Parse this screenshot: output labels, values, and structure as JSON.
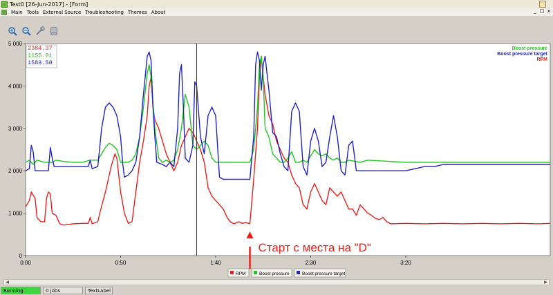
{
  "window": {
    "title": "Test0 [26-Jun-2017] - [Form]"
  },
  "menu": {
    "items": [
      "Main",
      "Tools",
      "External Source",
      "Troubleshooting",
      "Themes",
      "About"
    ],
    "controls": [
      "_",
      "□",
      "x"
    ]
  },
  "toolbar": {
    "buttons": [
      "zoom-in-icon",
      "zoom-out-icon",
      "settings-icon",
      "database-icon"
    ]
  },
  "readouts": [
    {
      "value": "2384.37",
      "color": "#e8201c"
    },
    {
      "value": "1155.91",
      "color": "#22c422"
    },
    {
      "value": "1583.58",
      "color": "#1e22c8"
    }
  ],
  "annotation": {
    "text": "Старт с места на \"D\"",
    "color": "#e8201c"
  },
  "chart_data": {
    "type": "line",
    "x_unit": "seconds",
    "xlim": [
      0,
      276
    ],
    "ylim": [
      0,
      5000
    ],
    "y_ticks": [
      "0",
      "1 000",
      "2 000",
      "3 000",
      "4 000",
      "5 000"
    ],
    "x_ticks": [
      {
        "value": 0,
        "label": "0:00"
      },
      {
        "value": 50,
        "label": "0:50"
      },
      {
        "value": 100,
        "label": "1:40"
      },
      {
        "value": 150,
        "label": "2:30"
      },
      {
        "value": 200,
        "label": "3:20"
      }
    ],
    "cursor_x": 90,
    "annotation_x": 118,
    "legend_top_right": [
      "Boost pressure",
      "Boost pressure target",
      "RPM"
    ],
    "legend_bottom": [
      "RPM",
      "Boost pressure",
      "Boost pressure target"
    ],
    "series": [
      {
        "name": "RPM",
        "color": "#e8201c",
        "points": [
          [
            0,
            1150
          ],
          [
            2,
            1300
          ],
          [
            3,
            1500
          ],
          [
            5,
            1350
          ],
          [
            6,
            900
          ],
          [
            8,
            800
          ],
          [
            10,
            800
          ],
          [
            11,
            1350
          ],
          [
            12,
            1500
          ],
          [
            13,
            1450
          ],
          [
            14,
            1000
          ],
          [
            16,
            950
          ],
          [
            18,
            750
          ],
          [
            20,
            720
          ],
          [
            25,
            750
          ],
          [
            30,
            760
          ],
          [
            33,
            760
          ],
          [
            34,
            900
          ],
          [
            35,
            750
          ],
          [
            38,
            800
          ],
          [
            39,
            1000
          ],
          [
            42,
            1500
          ],
          [
            45,
            2100
          ],
          [
            47,
            2400
          ],
          [
            48,
            2300
          ],
          [
            50,
            1500
          ],
          [
            52,
            1000
          ],
          [
            54,
            760
          ],
          [
            56,
            800
          ],
          [
            58,
            1500
          ],
          [
            60,
            2200
          ],
          [
            62,
            2700
          ],
          [
            64,
            3300
          ],
          [
            65,
            4000
          ],
          [
            66,
            4200
          ],
          [
            67,
            3500
          ],
          [
            68,
            3200
          ],
          [
            70,
            3000
          ],
          [
            72,
            2700
          ],
          [
            74,
            2400
          ],
          [
            76,
            2200
          ],
          [
            78,
            2000
          ],
          [
            80,
            2200
          ],
          [
            82,
            2600
          ],
          [
            84,
            2800
          ],
          [
            86,
            3000
          ],
          [
            88,
            2900
          ],
          [
            90,
            2700
          ],
          [
            92,
            2500
          ],
          [
            94,
            2200
          ],
          [
            95,
            1900
          ],
          [
            96,
            1600
          ],
          [
            98,
            1400
          ],
          [
            100,
            1300
          ],
          [
            102,
            1200
          ],
          [
            104,
            1100
          ],
          [
            106,
            900
          ],
          [
            108,
            780
          ],
          [
            110,
            750
          ],
          [
            112,
            800
          ],
          [
            114,
            760
          ],
          [
            116,
            780
          ],
          [
            118,
            750
          ],
          [
            120,
            1800
          ],
          [
            122,
            3000
          ],
          [
            123,
            4200
          ],
          [
            124,
            4700
          ],
          [
            125,
            4200
          ],
          [
            126,
            3800
          ],
          [
            128,
            3300
          ],
          [
            130,
            3100
          ],
          [
            132,
            2700
          ],
          [
            134,
            2500
          ],
          [
            136,
            2300
          ],
          [
            138,
            2200
          ],
          [
            140,
            1900
          ],
          [
            142,
            1700
          ],
          [
            144,
            1600
          ],
          [
            146,
            1200
          ],
          [
            148,
            1100
          ],
          [
            150,
            1500
          ],
          [
            152,
            1700
          ],
          [
            154,
            1500
          ],
          [
            156,
            1300
          ],
          [
            158,
            1200
          ],
          [
            160,
            1600
          ],
          [
            162,
            1500
          ],
          [
            164,
            1400
          ],
          [
            166,
            1500
          ],
          [
            168,
            1300
          ],
          [
            170,
            1100
          ],
          [
            172,
            1100
          ],
          [
            174,
            950
          ],
          [
            176,
            1200
          ],
          [
            178,
            1100
          ],
          [
            180,
            1000
          ],
          [
            182,
            950
          ],
          [
            184,
            880
          ],
          [
            186,
            850
          ],
          [
            188,
            900
          ],
          [
            190,
            800
          ],
          [
            192,
            750
          ],
          [
            200,
            760
          ],
          [
            210,
            750
          ],
          [
            220,
            760
          ],
          [
            230,
            750
          ],
          [
            240,
            760
          ],
          [
            250,
            750
          ],
          [
            260,
            760
          ],
          [
            270,
            750
          ],
          [
            276,
            760
          ]
        ]
      },
      {
        "name": "Boost pressure",
        "color": "#22c422",
        "points": [
          [
            0,
            2200
          ],
          [
            2,
            2250
          ],
          [
            4,
            2150
          ],
          [
            6,
            2250
          ],
          [
            10,
            2200
          ],
          [
            14,
            2200
          ],
          [
            16,
            2250
          ],
          [
            20,
            2220
          ],
          [
            25,
            2200
          ],
          [
            30,
            2200
          ],
          [
            34,
            2250
          ],
          [
            38,
            2250
          ],
          [
            40,
            2400
          ],
          [
            42,
            2550
          ],
          [
            44,
            2650
          ],
          [
            46,
            2600
          ],
          [
            48,
            2500
          ],
          [
            50,
            2200
          ],
          [
            54,
            2200
          ],
          [
            56,
            2250
          ],
          [
            58,
            2400
          ],
          [
            60,
            2800
          ],
          [
            62,
            3500
          ],
          [
            64,
            4300
          ],
          [
            65,
            4500
          ],
          [
            66,
            4200
          ],
          [
            68,
            3000
          ],
          [
            70,
            2300
          ],
          [
            72,
            2200
          ],
          [
            74,
            2250
          ],
          [
            76,
            2200
          ],
          [
            78,
            2250
          ],
          [
            80,
            2500
          ],
          [
            82,
            3000
          ],
          [
            84,
            3800
          ],
          [
            86,
            3500
          ],
          [
            88,
            2600
          ],
          [
            90,
            2500
          ],
          [
            92,
            2600
          ],
          [
            94,
            2700
          ],
          [
            96,
            2600
          ],
          [
            98,
            2300
          ],
          [
            100,
            2200
          ],
          [
            110,
            2200
          ],
          [
            118,
            2200
          ],
          [
            120,
            2500
          ],
          [
            122,
            3500
          ],
          [
            123,
            4500
          ],
          [
            124,
            4700
          ],
          [
            125,
            4200
          ],
          [
            126,
            3000
          ],
          [
            128,
            2800
          ],
          [
            130,
            2400
          ],
          [
            132,
            2300
          ],
          [
            134,
            2200
          ],
          [
            136,
            2200
          ],
          [
            138,
            2300
          ],
          [
            140,
            2450
          ],
          [
            142,
            2200
          ],
          [
            144,
            2200
          ],
          [
            146,
            2250
          ],
          [
            148,
            2200
          ],
          [
            150,
            2350
          ],
          [
            152,
            2500
          ],
          [
            154,
            2400
          ],
          [
            156,
            2350
          ],
          [
            158,
            2400
          ],
          [
            160,
            2300
          ],
          [
            162,
            2250
          ],
          [
            164,
            2300
          ],
          [
            166,
            2200
          ],
          [
            168,
            2200
          ],
          [
            170,
            2250
          ],
          [
            176,
            2200
          ],
          [
            180,
            2250
          ],
          [
            200,
            2200
          ],
          [
            250,
            2200
          ],
          [
            276,
            2200
          ]
        ]
      },
      {
        "name": "Boost pressure target",
        "color": "#1e22c8",
        "points": [
          [
            0,
            2000
          ],
          [
            2,
            2050
          ],
          [
            3,
            2600
          ],
          [
            4,
            2450
          ],
          [
            5,
            2000
          ],
          [
            10,
            2000
          ],
          [
            12,
            2000
          ],
          [
            13,
            2550
          ],
          [
            14,
            2300
          ],
          [
            15,
            2100
          ],
          [
            20,
            2100
          ],
          [
            30,
            2100
          ],
          [
            33,
            2100
          ],
          [
            34,
            2250
          ],
          [
            35,
            2050
          ],
          [
            38,
            2100
          ],
          [
            40,
            3000
          ],
          [
            42,
            3500
          ],
          [
            44,
            3600
          ],
          [
            46,
            3500
          ],
          [
            48,
            3300
          ],
          [
            50,
            2800
          ],
          [
            51,
            2200
          ],
          [
            52,
            1850
          ],
          [
            54,
            1900
          ],
          [
            56,
            2000
          ],
          [
            58,
            2200
          ],
          [
            60,
            2800
          ],
          [
            62,
            3800
          ],
          [
            64,
            4700
          ],
          [
            65,
            4800
          ],
          [
            66,
            4600
          ],
          [
            67,
            3500
          ],
          [
            68,
            2800
          ],
          [
            69,
            2200
          ],
          [
            72,
            2150
          ],
          [
            74,
            2100
          ],
          [
            76,
            2200
          ],
          [
            78,
            2100
          ],
          [
            80,
            3000
          ],
          [
            81,
            4300
          ],
          [
            82,
            4500
          ],
          [
            83,
            3500
          ],
          [
            84,
            2300
          ],
          [
            86,
            2200
          ],
          [
            88,
            2600
          ],
          [
            89,
            4100
          ],
          [
            90,
            4000
          ],
          [
            92,
            2800
          ],
          [
            94,
            2400
          ],
          [
            96,
            3300
          ],
          [
            98,
            3500
          ],
          [
            100,
            3300
          ],
          [
            102,
            1850
          ],
          [
            104,
            1800
          ],
          [
            110,
            1800
          ],
          [
            118,
            1800
          ],
          [
            120,
            2800
          ],
          [
            121,
            4500
          ],
          [
            122,
            4800
          ],
          [
            123,
            4600
          ],
          [
            124,
            3900
          ],
          [
            125,
            4500
          ],
          [
            126,
            4700
          ],
          [
            128,
            3900
          ],
          [
            130,
            2900
          ],
          [
            132,
            2800
          ],
          [
            134,
            2400
          ],
          [
            136,
            2100
          ],
          [
            138,
            2000
          ],
          [
            140,
            3400
          ],
          [
            142,
            3600
          ],
          [
            144,
            3400
          ],
          [
            146,
            2100
          ],
          [
            148,
            1900
          ],
          [
            150,
            2700
          ],
          [
            152,
            3000
          ],
          [
            154,
            2700
          ],
          [
            156,
            2100
          ],
          [
            158,
            2200
          ],
          [
            160,
            2800
          ],
          [
            162,
            3300
          ],
          [
            164,
            2800
          ],
          [
            166,
            2000
          ],
          [
            168,
            1900
          ],
          [
            170,
            2600
          ],
          [
            172,
            2700
          ],
          [
            174,
            2000
          ],
          [
            176,
            2000
          ],
          [
            180,
            2000
          ],
          [
            190,
            2000
          ],
          [
            200,
            2000
          ],
          [
            210,
            2100
          ],
          [
            215,
            2100
          ],
          [
            220,
            2150
          ],
          [
            250,
            2150
          ],
          [
            276,
            2150
          ]
        ]
      }
    ]
  },
  "status": {
    "running": "Running",
    "jobs": "0 jobs",
    "label": "TextLabel"
  }
}
